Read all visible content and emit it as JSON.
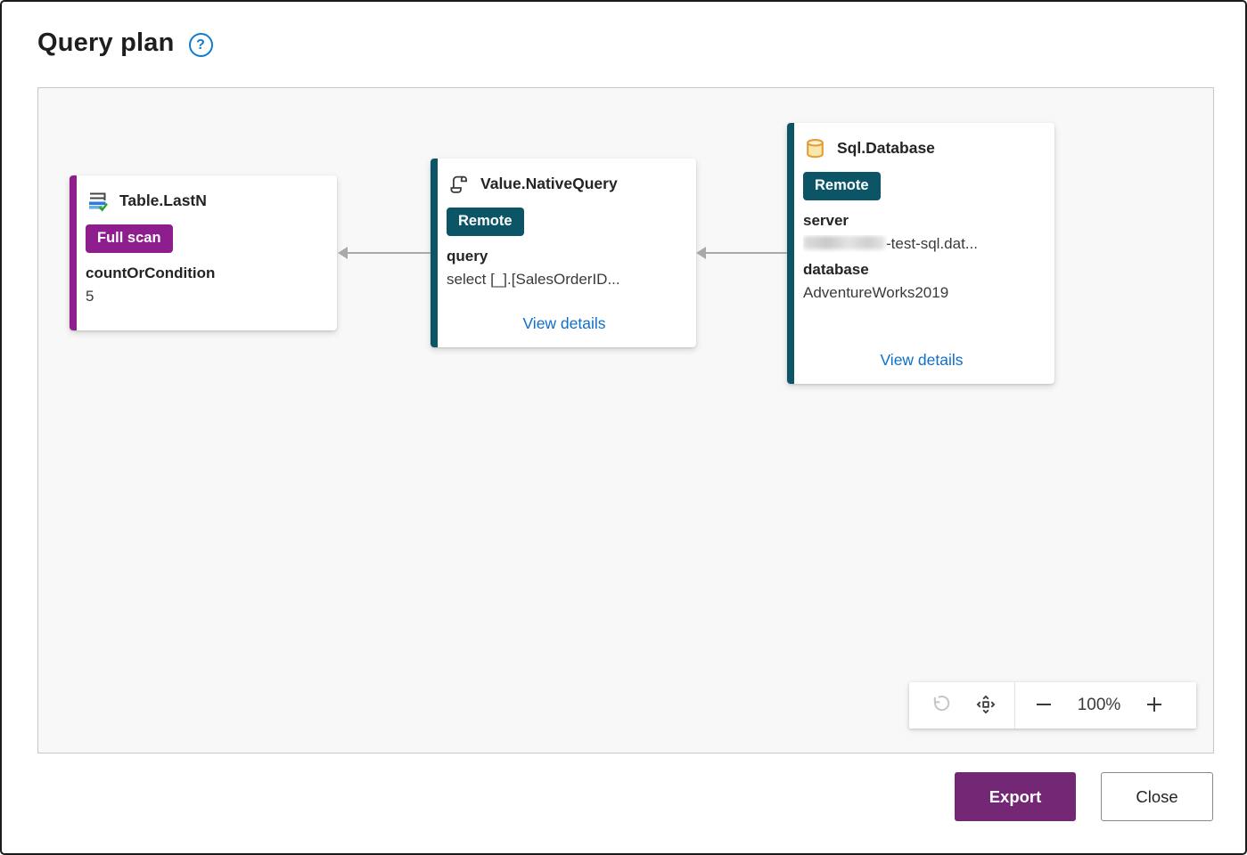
{
  "header": {
    "title": "Query plan"
  },
  "nodes": [
    {
      "id": "table-lastn",
      "title": "Table.LastN",
      "icon": "keep-last-rows-icon",
      "accent_color": "#8e1d8e",
      "badge": {
        "label": "Full scan",
        "color": "#8e1d8e"
      },
      "fields": [
        {
          "label": "countOrCondition",
          "value": "5"
        }
      ]
    },
    {
      "id": "value-nativequery",
      "title": "Value.NativeQuery",
      "icon": "script-scroll-icon",
      "accent_color": "#0b5567",
      "badge": {
        "label": "Remote",
        "color": "#0b5567"
      },
      "fields": [
        {
          "label": "query",
          "value": "select [_].[SalesOrderID..."
        }
      ],
      "link_label": "View details"
    },
    {
      "id": "sql-database",
      "title": "Sql.Database",
      "icon": "database-icon",
      "accent_color": "#0b5567",
      "badge": {
        "label": "Remote",
        "color": "#0b5567"
      },
      "fields": [
        {
          "label": "server",
          "value": "-test-sql.dat...",
          "redacted_prefix": true
        },
        {
          "label": "database",
          "value": "AdventureWorks2019"
        }
      ],
      "link_label": "View details"
    }
  ],
  "canvas_toolbar": {
    "reset_icon": "undo-icon",
    "fit_icon": "fit-to-view-icon",
    "zoom_level": "100%"
  },
  "footer": {
    "export_label": "Export",
    "close_label": "Close"
  },
  "colors": {
    "accent_purple": "#8e1d8e",
    "accent_teal": "#0b5567",
    "link_blue": "#0f6fc8",
    "export_purple": "#742774",
    "arrow_gray": "#a9a9a9",
    "canvas_bg": "#f8f8f8"
  }
}
